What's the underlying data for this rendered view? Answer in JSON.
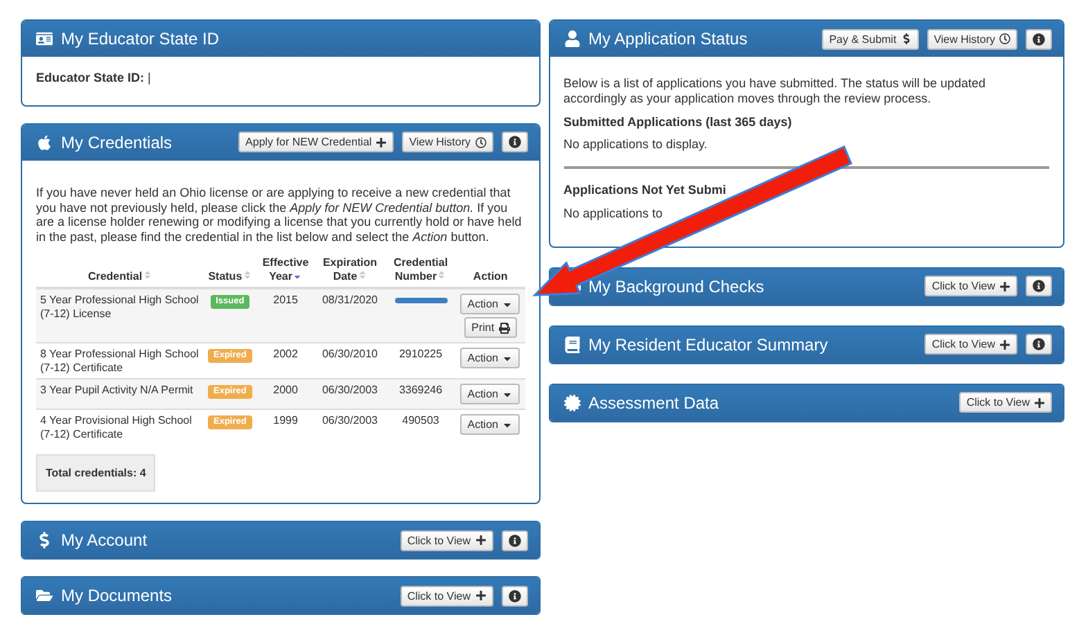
{
  "left": [
    {
      "kind": "id",
      "title": "My Educator State ID",
      "info": false,
      "field_label": "Educator State ID:",
      "field_value": "|"
    },
    {
      "kind": "credentials",
      "title": "My Credentials",
      "info": true,
      "buttons": [
        {
          "label": "Apply for NEW Credential",
          "kind": "add"
        },
        {
          "label": "View History",
          "kind": "history"
        }
      ],
      "intro": "If you have never held an Ohio license or are applying to receive a new credential that you have not previously held, please click the *Apply for NEW Credential button.* If you are a license holder renewing or modifying a license that you currently hold or have held in the past, please find the credential in the list below and select the *Action* button.",
      "columns": [
        {
          "label": "Credential",
          "sortable": true,
          "sorted": false
        },
        {
          "label": "Status",
          "sortable": true,
          "sorted": false
        },
        {
          "label": "Effective Year",
          "sortable": true,
          "sorted": true
        },
        {
          "label": "Expiration Date",
          "sortable": true,
          "sorted": false
        },
        {
          "label": "Credential Number",
          "sortable": true,
          "sorted": false
        },
        {
          "label": "Action",
          "sortable": false
        }
      ],
      "rows": [
        {
          "credential": "5 Year Professional High School (7-12) License",
          "status": "Issued",
          "color": "#5cb85c",
          "year": "2015",
          "expires": "08/31/2020",
          "number_redacted": true,
          "buttons": [
            {
              "label": "Action",
              "kind": "dropdown"
            },
            {
              "label": "Print",
              "kind": "print"
            }
          ]
        },
        {
          "credential": "8 Year Professional High School (7-12) Certificate",
          "status": "Expired",
          "color": "#f0ad4e",
          "year": "2002",
          "expires": "06/30/2010",
          "number": "2910225",
          "buttons": [
            {
              "label": "Action",
              "kind": "dropdown"
            }
          ]
        },
        {
          "credential": "3 Year Pupil Activity N/A Permit",
          "status": "Expired",
          "color": "#f0ad4e",
          "year": "2000",
          "expires": "06/30/2003",
          "number": "3369246",
          "buttons": [
            {
              "label": "Action",
              "kind": "dropdown"
            }
          ]
        },
        {
          "credential": "4 Year Provisional High School (7-12) Certificate",
          "status": "Expired",
          "color": "#f0ad4e",
          "year": "1999",
          "expires": "06/30/2003",
          "number": "490503",
          "buttons": [
            {
              "label": "Action",
              "kind": "dropdown"
            }
          ]
        }
      ],
      "total": "Total credentials: 4"
    },
    {
      "kind": "collapsed",
      "title": "My Account",
      "info": true,
      "buttons": [
        {
          "label": "Click to View",
          "kind": "add"
        }
      ]
    },
    {
      "kind": "collapsed",
      "title": "My Documents",
      "info": true,
      "buttons": [
        {
          "label": "Click to View",
          "kind": "add"
        }
      ]
    }
  ],
  "right": [
    {
      "kind": "application",
      "title": "My Application Status",
      "info": true,
      "buttons": [
        {
          "label": "Pay & Submit",
          "kind": "pay"
        },
        {
          "label": "View History",
          "kind": "history"
        }
      ],
      "intro": "Below is a list of applications you have submitted. The status will be updated accordingly as your application moves through the review process.",
      "sections": [
        {
          "heading": "Submitted Applications (last 365 days)",
          "note": "No applications to display."
        },
        {
          "heading": "Applications Not Yet Submi",
          "note": "No applications to"
        }
      ]
    },
    {
      "kind": "collapsed",
      "title": "My Background Checks",
      "info": true,
      "buttons": [
        {
          "label": "Click to View",
          "kind": "add"
        }
      ]
    },
    {
      "kind": "collapsed",
      "title": "My Resident Educator Summary",
      "info": true,
      "buttons": [
        {
          "label": "Click to View",
          "kind": "add"
        }
      ]
    },
    {
      "kind": "collapsed",
      "title": "Assessment Data",
      "info": false,
      "buttons": [
        {
          "label": "Click to View",
          "kind": "add"
        }
      ]
    }
  ]
}
